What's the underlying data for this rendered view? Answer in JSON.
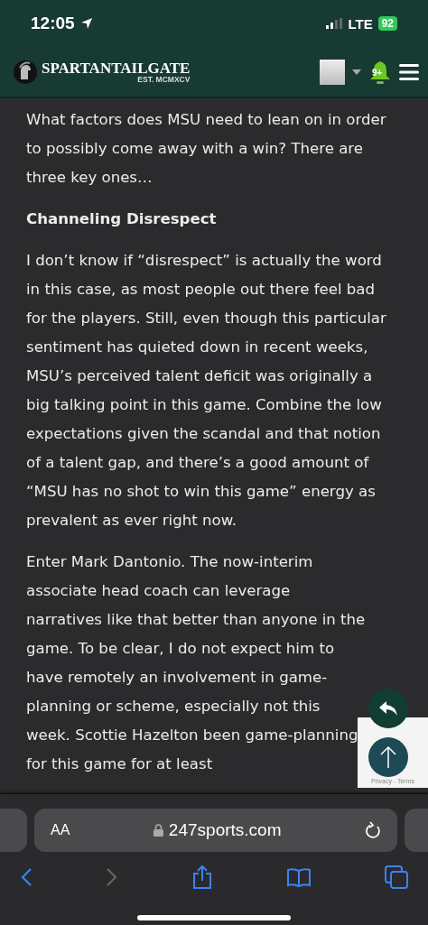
{
  "status_bar": {
    "time": "12:05",
    "network": "LTE",
    "battery": "92"
  },
  "header": {
    "logo_title": "SPARTANTAILGATE",
    "logo_subtitle": "EST. MCMXCV",
    "notification_count": "9+"
  },
  "article": [
    {
      "kind": "paragraph",
      "text": "What factors does MSU need to lean on in order to possibly come away with a win? There are three key ones…"
    },
    {
      "kind": "heading",
      "text": "Channeling Disrespect"
    },
    {
      "kind": "paragraph",
      "text": "I don’t know if “disrespect” is actually the word in this case, as most people out there feel bad for the players. Still, even though this particular sentiment has quieted down in recent weeks, MSU’s perceived talent deficit was originally a big talking point in this game. Combine the low expectations given the scandal and that notion of a talent gap, and there’s a good amount of “MSU has no shot to win this game” energy as prevalent as ever right now."
    },
    {
      "kind": "paragraph",
      "text": "Enter Mark Dantonio. The now-interim associate head coach can leverage narratives like that better than anyone in the game. To be clear, I do not expect him to have remotely an involvement in game-planning or scheme, especially not this week. Scottie Hazelton been game-planning for this game for at least"
    }
  ],
  "recaptcha": {
    "text": "Privacy - Terms"
  },
  "browser": {
    "text_size": "AA",
    "url": "247sports.com",
    "back_disabled": false,
    "forward_disabled": true
  }
}
